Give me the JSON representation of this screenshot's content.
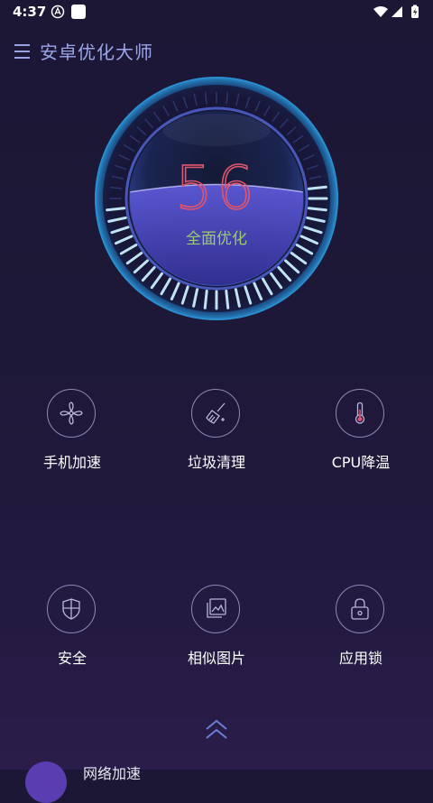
{
  "status_bar": {
    "time": "4:37"
  },
  "header": {
    "menu_icon": "menu-icon",
    "title": "安卓优化大师"
  },
  "gauge": {
    "score": "56",
    "action_label": "全面优化",
    "level_percent": 56
  },
  "features": [
    {
      "label": "手机加速",
      "icon": "fan-icon"
    },
    {
      "label": "垃圾清理",
      "icon": "broom-icon"
    },
    {
      "label": "CPU降温",
      "icon": "thermometer-icon"
    },
    {
      "label": "安全",
      "icon": "shield-icon"
    },
    {
      "label": "相似图片",
      "icon": "gallery-icon"
    },
    {
      "label": "应用锁",
      "icon": "lock-icon"
    }
  ],
  "bottom_panel": {
    "expand_icon": "double-chevron-up-icon",
    "peek_item_label": "网络加速"
  },
  "colors": {
    "score": "#e0556d",
    "action": "#9ccb6a",
    "title": "#9aa6e8",
    "ring": "#8c88b8"
  }
}
